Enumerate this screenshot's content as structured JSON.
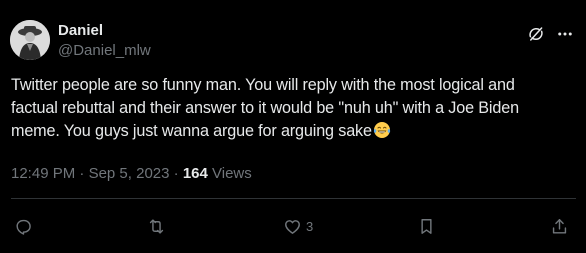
{
  "author": {
    "display_name": "Daniel",
    "handle": "@Daniel_mlw",
    "avatar": "avatar"
  },
  "tweet": {
    "lines": [
      "Twitter people are so funny man. You will reply with the most logical and",
      "factual rebuttal and their answer to it would be \"nuh uh\" with a Joe Biden",
      "meme. You guys just wanna argue for arguing sake"
    ],
    "emoji": "laughing-tears-emoji"
  },
  "meta": {
    "time": "12:49 PM",
    "separator": " · ",
    "date": "Sep 5, 2023",
    "views_count": "164",
    "views_label": " Views"
  },
  "actions": {
    "reply_icon": "reply-icon",
    "retweet_icon": "retweet-icon",
    "like_icon": "like-icon",
    "like_count": "3",
    "bookmark_icon": "bookmark-icon",
    "share_icon": "share-icon"
  },
  "header_icons": {
    "grok": "grok-icon",
    "more": "more-icon"
  },
  "colors": {
    "background": "#000000",
    "primary_text": "#e7e9ea",
    "secondary_text": "#71767b",
    "divider": "#2f3336"
  }
}
